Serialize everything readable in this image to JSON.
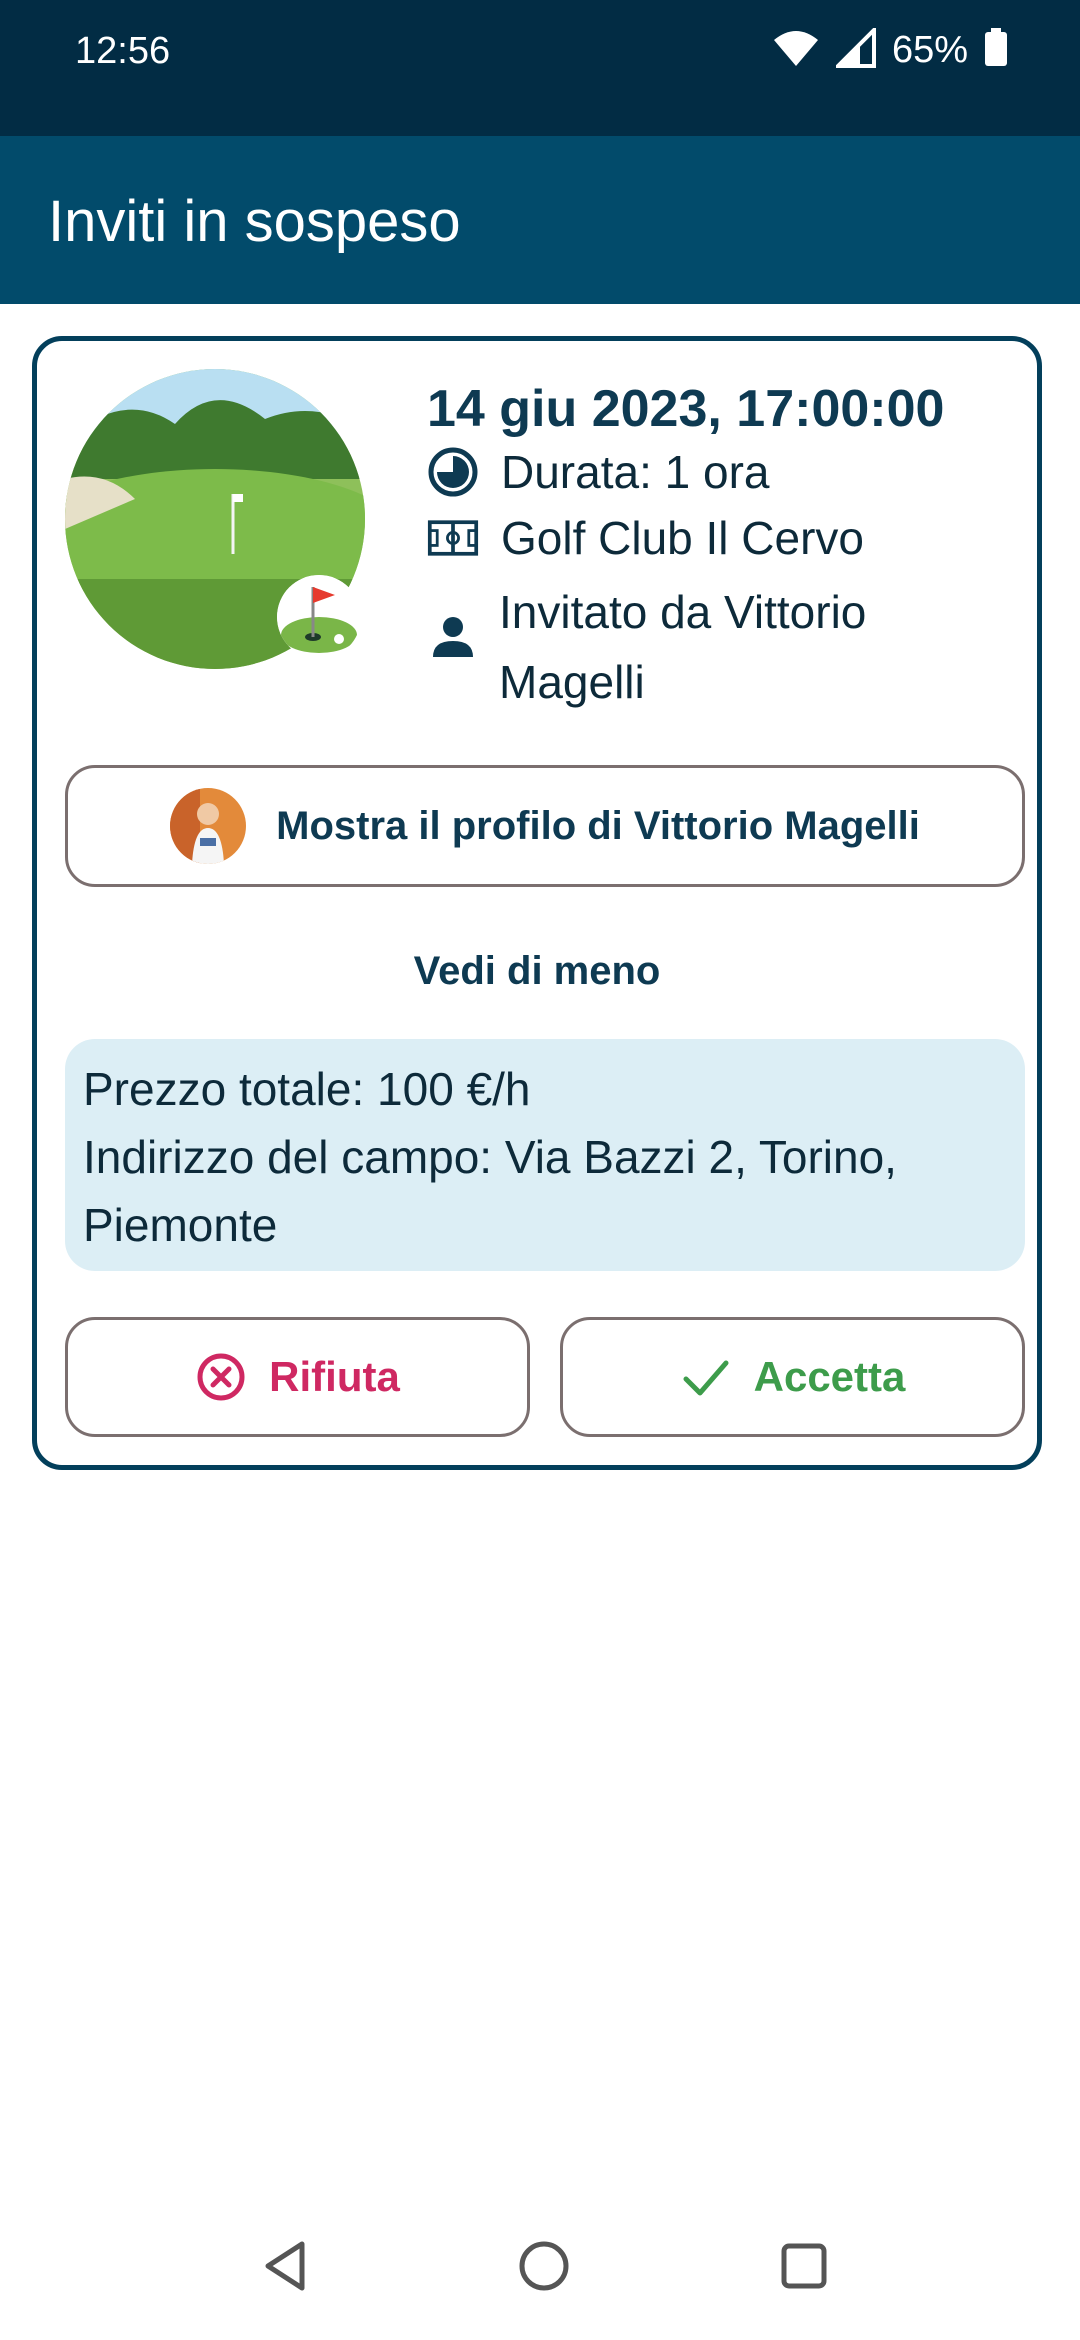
{
  "status": {
    "time": "12:56",
    "battery": "65%",
    "icons": [
      "wifi-icon",
      "signal-icon",
      "battery-icon"
    ]
  },
  "app_bar": {
    "title": "Inviti in sospeso"
  },
  "invite": {
    "datetime": "14 giu 2023, 17:00:00",
    "duration": "Durata: 1 ora",
    "club": "Golf Club Il Cervo",
    "invited_by": "Invitato da Vittorio Magelli",
    "profile_button": "Mostra il profilo di Vittorio Magelli",
    "toggle_details": "Vedi di meno",
    "price": "Prezzo totale: 100 €/h",
    "address": "Indirizzo del campo: Via Bazzi 2, Torino, Piemonte",
    "reject_label": "Rifiuta",
    "accept_label": "Accetta"
  },
  "colors": {
    "status_bar": "#022c44",
    "app_bar": "#024b6b",
    "accent": "#0e3a52",
    "details_bg": "#dceef5",
    "reject": "#cf2862",
    "accept": "#3d9c4b"
  },
  "nav": {
    "icons": [
      "back-icon",
      "home-icon",
      "recents-icon"
    ]
  }
}
